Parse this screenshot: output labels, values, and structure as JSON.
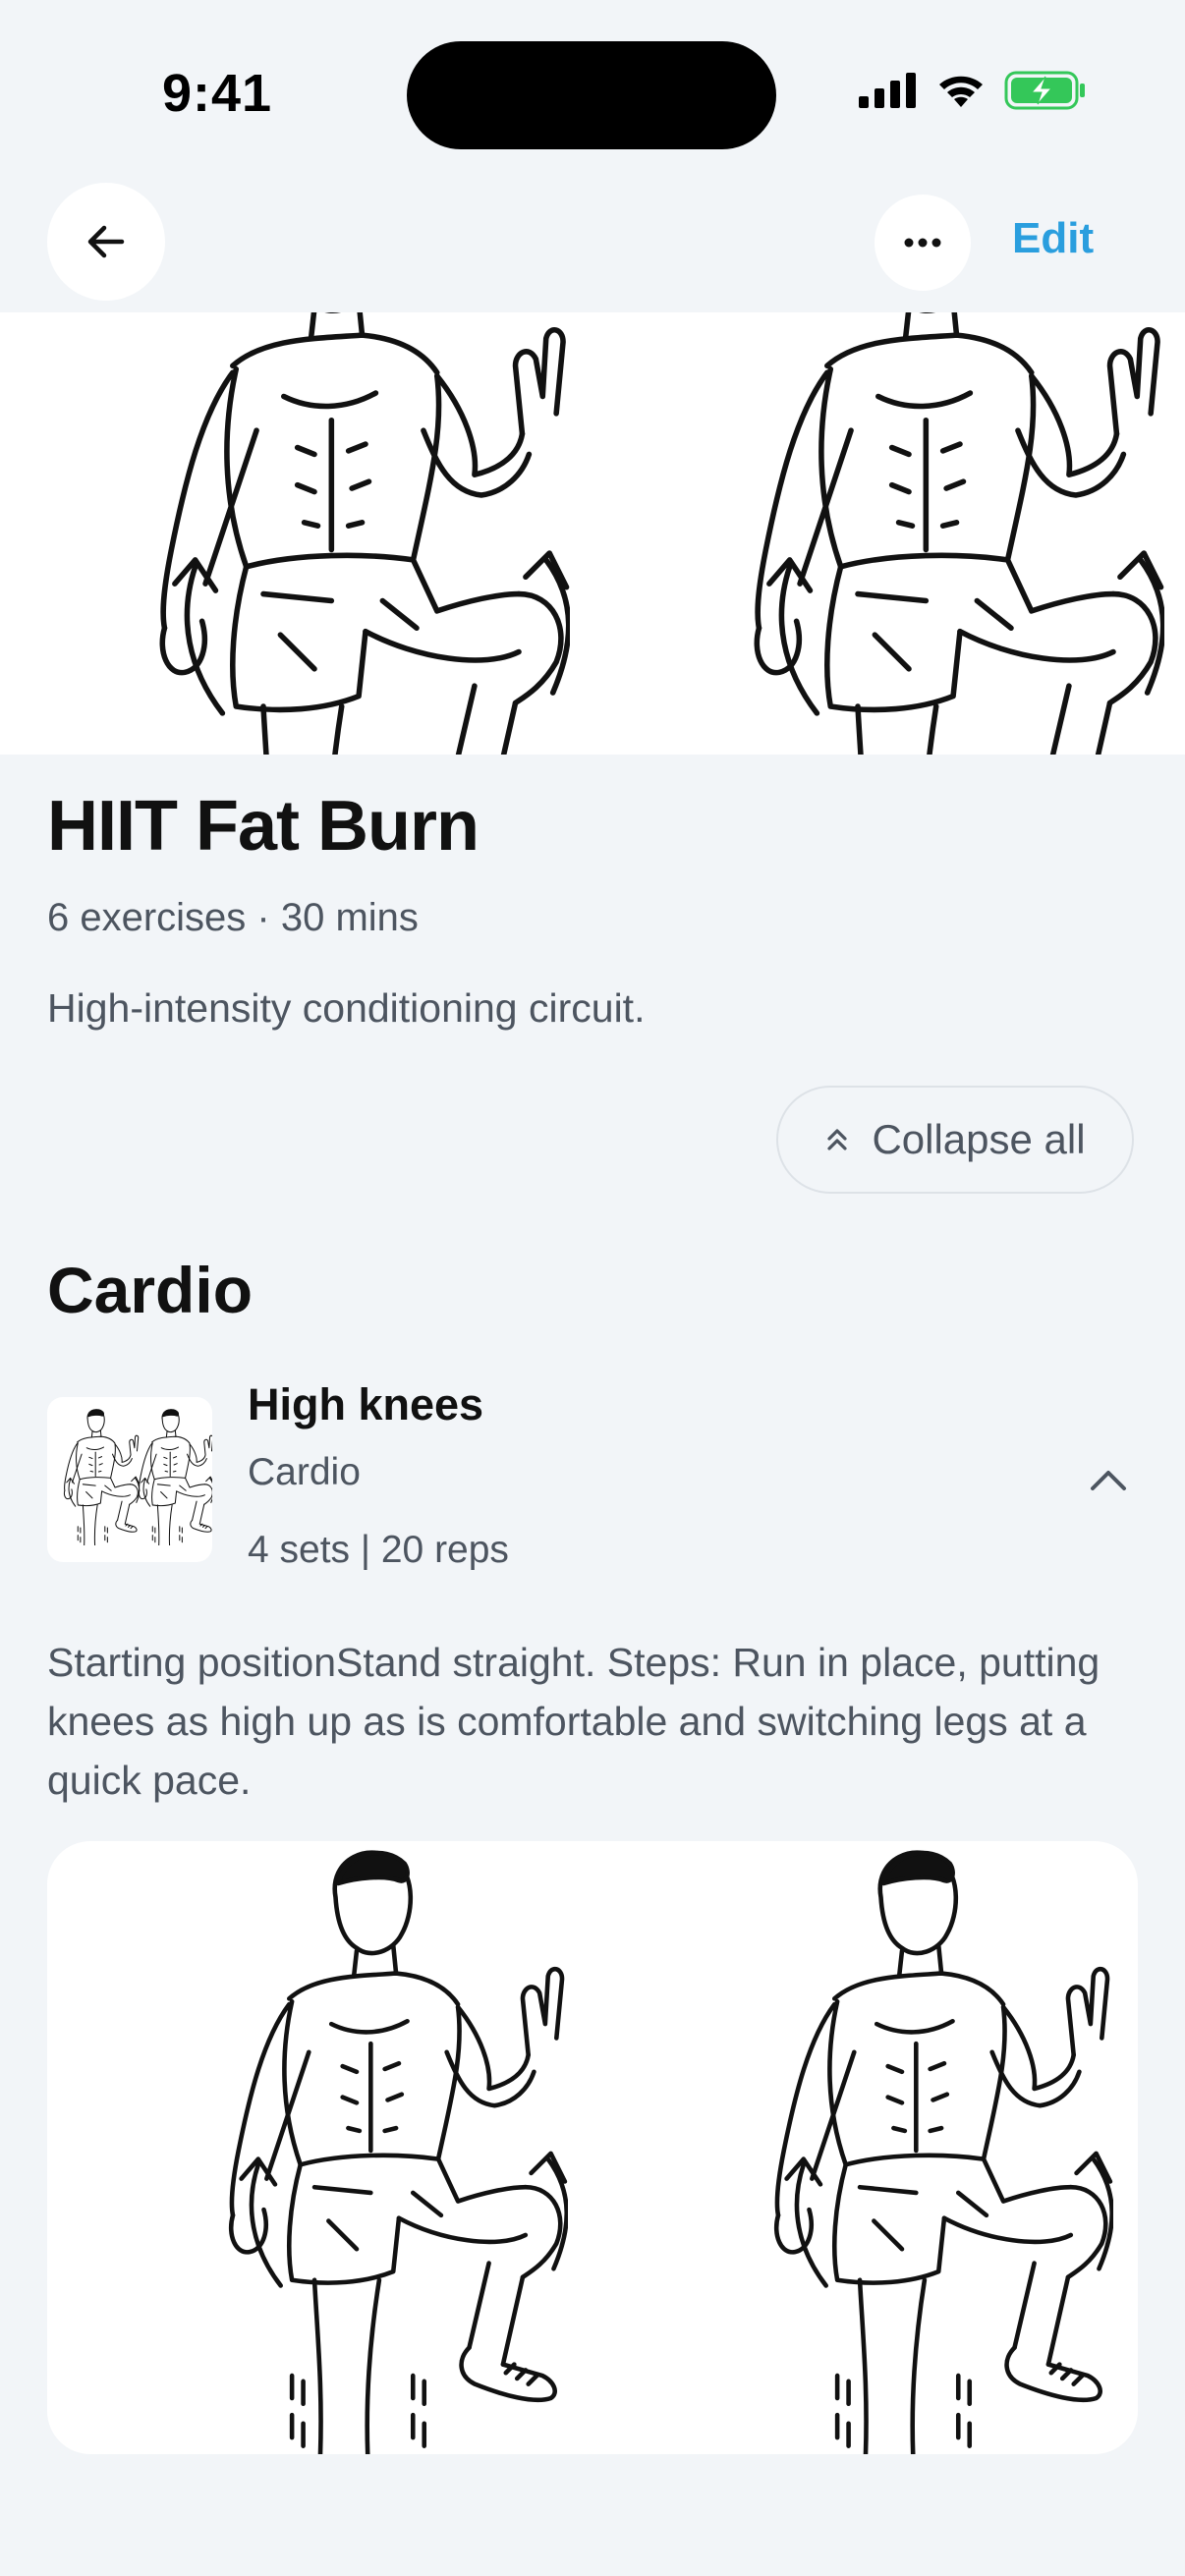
{
  "status_bar": {
    "time": "9:41",
    "icons": [
      "cellular-signal-icon",
      "wifi-icon",
      "battery-charging-icon"
    ],
    "battery_color": "#34c759"
  },
  "nav": {
    "back_icon": "arrow-left-icon",
    "more_icon": "more-horizontal-icon",
    "edit_label": "Edit",
    "accent_color": "#2a9ede"
  },
  "hero": {
    "image": "high-knees-illustration"
  },
  "workout": {
    "title": "HIIT Fat Burn",
    "meta": "6 exercises · 30 mins",
    "description": "High-intensity conditioning circuit.",
    "collapse_label": "Collapse all",
    "collapse_icon": "chevrons-up-icon"
  },
  "sections": [
    {
      "title": "Cardio",
      "exercises": [
        {
          "name": "High knees",
          "category": "Cardio",
          "sets_reps": "4 sets | 20 reps",
          "expanded": true,
          "chevron_icon": "chevron-up-icon",
          "description": "Starting positionStand straight. Steps: Run in place, putting knees as high up as is comfortable and switching legs at a quick pace.",
          "image": "high-knees-illustration"
        }
      ]
    }
  ]
}
